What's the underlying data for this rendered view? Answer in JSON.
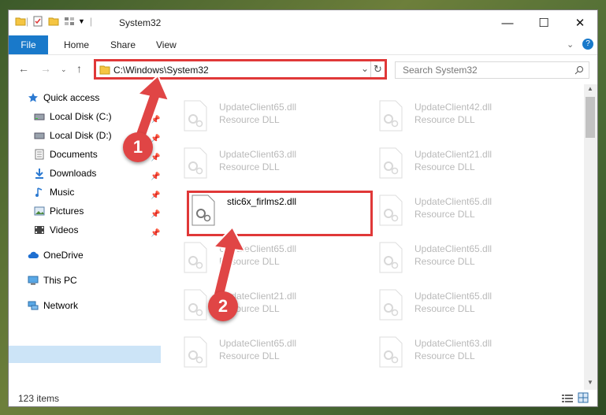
{
  "window": {
    "title": "System32",
    "controls": {
      "minimize": "—",
      "maximize": "☐",
      "close": "✕"
    }
  },
  "ribbon": {
    "file": "File",
    "tabs": [
      "Home",
      "Share",
      "View"
    ]
  },
  "address": {
    "path": "C:\\Windows\\System32",
    "search_placeholder": "Search System32"
  },
  "sidebar": {
    "items": [
      {
        "label": "Quick access",
        "icon": "star-icon",
        "pinned": false
      },
      {
        "label": "Local Disk (C:)",
        "icon": "drive-icon",
        "pinned": true
      },
      {
        "label": "Local Disk (D:)",
        "icon": "drive-icon",
        "pinned": true
      },
      {
        "label": "Documents",
        "icon": "documents-icon",
        "pinned": true
      },
      {
        "label": "Downloads",
        "icon": "downloads-icon",
        "pinned": true
      },
      {
        "label": "Music",
        "icon": "music-icon",
        "pinned": true
      },
      {
        "label": "Pictures",
        "icon": "pictures-icon",
        "pinned": true
      },
      {
        "label": "Videos",
        "icon": "videos-icon",
        "pinned": true
      },
      {
        "label": "OneDrive",
        "icon": "cloud-icon",
        "pinned": false
      },
      {
        "label": "This PC",
        "icon": "pc-icon",
        "pinned": false,
        "selected": true
      },
      {
        "label": "Network",
        "icon": "network-icon",
        "pinned": false
      }
    ]
  },
  "files": {
    "left": [
      {
        "name": "UpdateClient65.dll",
        "type": "Resource DLL"
      },
      {
        "name": "UpdateClient63.dll",
        "type": "Resource DLL"
      },
      {
        "name": "stic6x_firlms2.dll",
        "type": "",
        "highlighted": true
      },
      {
        "name": "UpdateClient65.dll",
        "type": "Resource DLL"
      },
      {
        "name": "UpdateClient21.dll",
        "type": "Resource DLL"
      },
      {
        "name": "UpdateClient65.dll",
        "type": "Resource DLL"
      }
    ],
    "right": [
      {
        "name": "UpdateClient42.dll",
        "type": "Resource DLL"
      },
      {
        "name": "UpdateClient21.dll",
        "type": "Resource DLL"
      },
      {
        "name": "UpdateClient65.dll",
        "type": "Resource DLL"
      },
      {
        "name": "UpdateClient65.dll",
        "type": "Resource DLL"
      },
      {
        "name": "UpdateClient65.dll",
        "type": "Resource DLL"
      },
      {
        "name": "UpdateClient63.dll",
        "type": "Resource DLL"
      }
    ]
  },
  "status": {
    "count": "123 items"
  },
  "annotations": {
    "badge1": "1",
    "badge2": "2"
  },
  "colors": {
    "accent": "#1979ca",
    "highlight": "#e03838",
    "selected": "#cce4f7"
  }
}
